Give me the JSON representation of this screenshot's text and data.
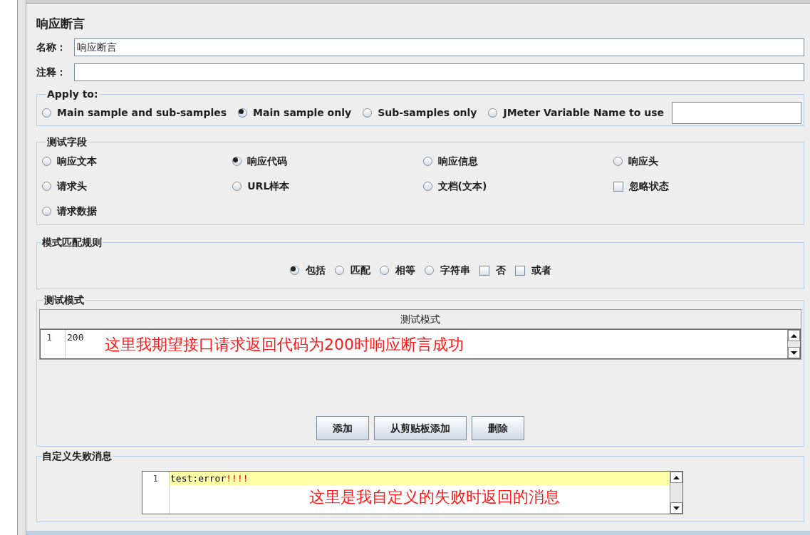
{
  "title": "响应断言",
  "name_field": {
    "label": "名称：",
    "value": "响应断言"
  },
  "comment_field": {
    "label": "注释："
  },
  "apply_to": {
    "legend": "Apply to:",
    "options": [
      {
        "label": "Main sample and sub-samples",
        "selected": false
      },
      {
        "label": "Main sample only",
        "selected": true
      },
      {
        "label": "Sub-samples only",
        "selected": false
      },
      {
        "label": "JMeter Variable Name to use",
        "selected": false
      }
    ]
  },
  "test_fields": {
    "legend": "测试字段",
    "options": [
      {
        "label": "响应文本",
        "kind": "radio",
        "checked": false
      },
      {
        "label": "响应代码",
        "kind": "radio",
        "checked": true
      },
      {
        "label": "响应信息",
        "kind": "radio",
        "checked": false
      },
      {
        "label": "响应头",
        "kind": "radio",
        "checked": false
      },
      {
        "label": "请求头",
        "kind": "radio",
        "checked": false
      },
      {
        "label": "URL样本",
        "kind": "radio",
        "checked": false
      },
      {
        "label": "文档(文本)",
        "kind": "radio",
        "checked": false
      },
      {
        "label": "忽略状态",
        "kind": "checkbox",
        "checked": false
      },
      {
        "label": "请求数据",
        "kind": "radio",
        "checked": false
      }
    ]
  },
  "pattern_rules": {
    "legend": "模式匹配规则",
    "options": [
      {
        "label": "包括",
        "kind": "radio",
        "checked": true
      },
      {
        "label": "匹配",
        "kind": "radio",
        "checked": false
      },
      {
        "label": "相等",
        "kind": "radio",
        "checked": false
      },
      {
        "label": "字符串",
        "kind": "radio",
        "checked": false
      },
      {
        "label": "否",
        "kind": "checkbox",
        "checked": false
      },
      {
        "label": "或者",
        "kind": "checkbox",
        "checked": false
      }
    ]
  },
  "test_patterns": {
    "legend": "测试模式",
    "column": "测试模式",
    "rows": [
      {
        "line": "1",
        "value": "200"
      }
    ],
    "annotation": "这里我期望接口请求返回代码为200时响应断言成功",
    "buttons": [
      "添加",
      "从剪贴板添加",
      "删除"
    ]
  },
  "failure_message": {
    "legend": "自定义失败消息",
    "lines": [
      {
        "line": "1",
        "segments": [
          {
            "text": "test:error",
            "kind": "plain"
          },
          {
            "text": "!!!!",
            "kind": "operator"
          }
        ]
      }
    ],
    "annotation": "这里是我自定义的失败时返回的消息"
  }
}
